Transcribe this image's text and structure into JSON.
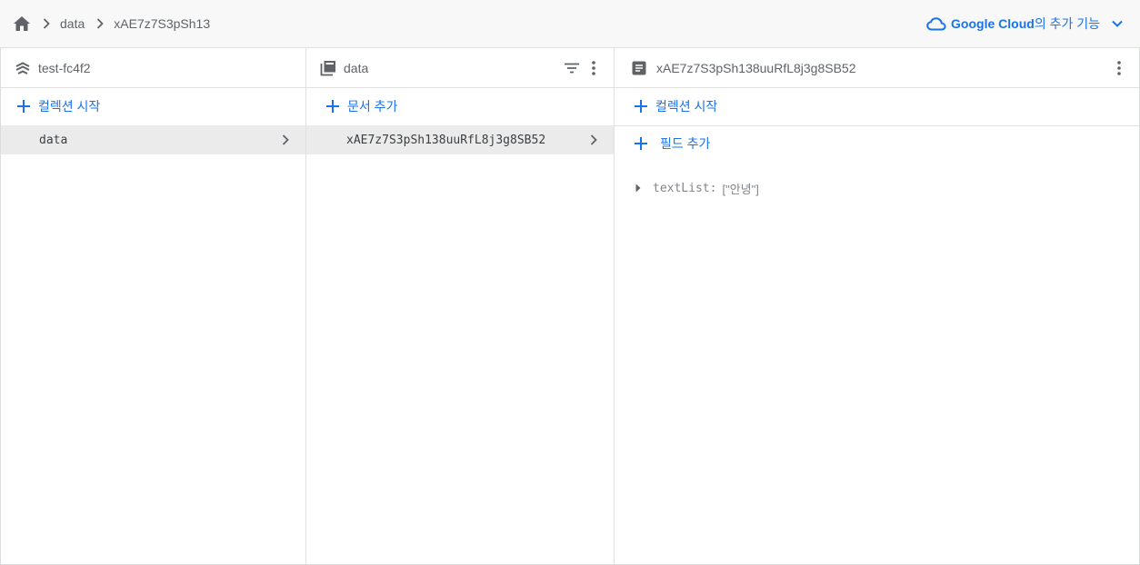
{
  "breadcrumb": {
    "items": [
      "data",
      "xAE7z7S3pSh13"
    ]
  },
  "top_right": {
    "brand": "Google Cloud",
    "suffix": "의 추가 기능"
  },
  "panels": {
    "project": {
      "title": "test-fc4f2",
      "add_label": "컬렉션 시작",
      "items": [
        {
          "label": "data"
        }
      ]
    },
    "collection": {
      "title": "data",
      "add_label": "문서 추가",
      "items": [
        {
          "label": "xAE7z7S3pSh138uuRfL8j3g8SB52"
        }
      ]
    },
    "document": {
      "title": "xAE7z7S3pSh138uuRfL8j3g8SB52",
      "add_collection_label": "컬렉션 시작",
      "add_field_label": "필드 추가",
      "fields": [
        {
          "key": "textList:",
          "value": "[\"안녕\"]"
        }
      ]
    }
  },
  "colors": {
    "accent": "#1a73e8",
    "selected_row": "#ebebeb",
    "topbar_bg": "#f8f8f8"
  },
  "icons": {
    "home": "home-icon",
    "separator": "chevron-right-icon",
    "cloud": "cloud-icon",
    "expand": "chevron-down-icon",
    "project": "firestore-project-icon",
    "collection": "collection-icon",
    "document": "document-icon",
    "filter": "filter-icon",
    "more": "more-vert-icon",
    "add": "plus-icon",
    "expand_field": "triangle-right-icon"
  }
}
